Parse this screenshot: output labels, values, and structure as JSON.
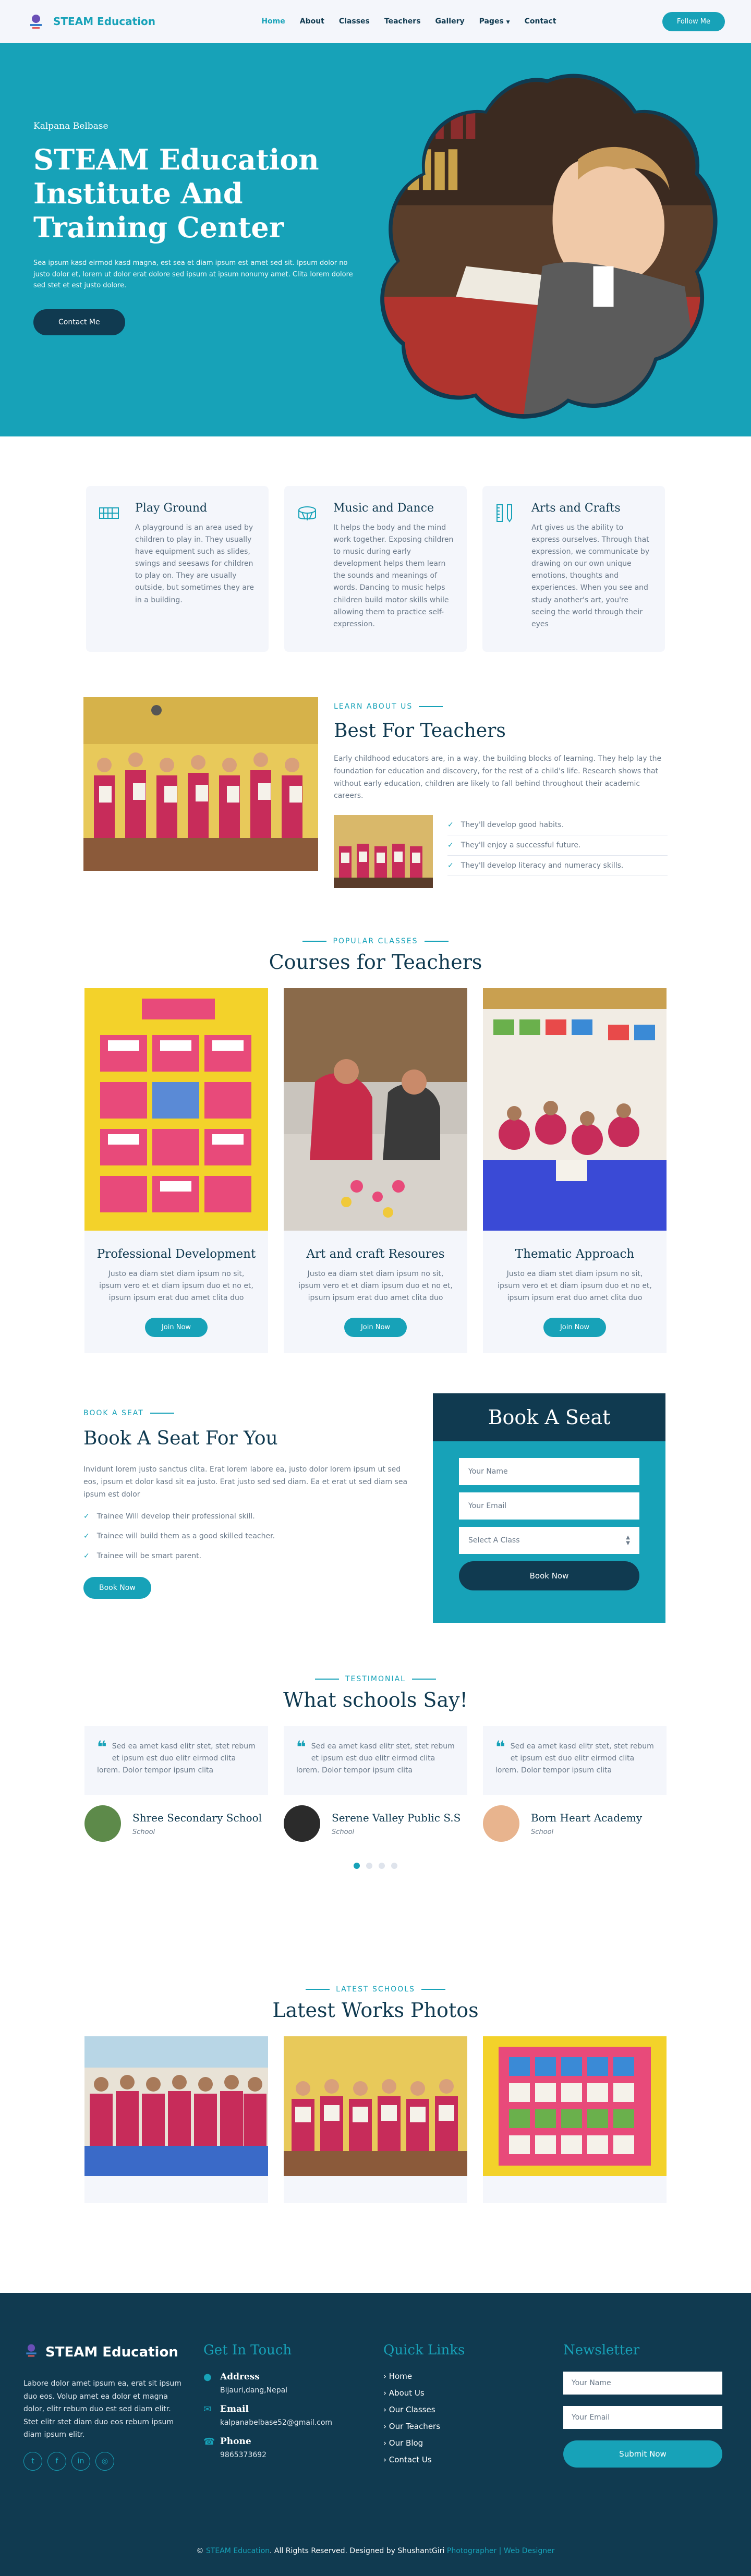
{
  "nav": {
    "brand": "STEAM Education",
    "items": [
      "Home",
      "About",
      "Classes",
      "Teachers",
      "Gallery",
      "Pages",
      "Contact"
    ],
    "follow_label": "Follow Me"
  },
  "hero": {
    "kicker": "Kalpana Belbase",
    "title": "STEAM Education Institute And Training Center",
    "desc": "Sea ipsum kasd eirmod kasd magna, est sea et diam ipsum est amet sed sit. Ipsum dolor no justo dolor et, lorem ut dolor erat dolore sed ipsum at ipsum nonumy amet. Clita lorem dolore sed stet et est justo dolore.",
    "cta": "Contact Me"
  },
  "facilities": [
    {
      "icon": "fence-icon",
      "title": "Play Ground",
      "text": "A playground is an area used by children to play in. They usually have equipment such as slides, swings and seesaws for children to play on. They are usually outside, but sometimes they are in a building."
    },
    {
      "icon": "drum-icon",
      "title": "Music and Dance",
      "text": "It helps the body and the mind work together. Exposing children to music during early development helps them learn the sounds and meanings of words. Dancing to music helps children build motor skills while allowing them to practice self-expression."
    },
    {
      "icon": "pencil-ruler-icon",
      "title": "Arts and Crafts",
      "text": "Art gives us the ability to express ourselves. Through that expression, we communicate by drawing on our own unique emotions, thoughts and experiences. When you see and study another's art, you're seeing the world through their eyes"
    }
  ],
  "about": {
    "kicker": "LEARN ABOUT US",
    "title": "Best For Teachers",
    "desc": "Early childhood educators are, in a way, the building blocks of learning. They help lay the foundation for education and discovery, for the rest of a child's life. Research shows that without early education, children are likely to fall behind throughout their academic careers.",
    "checks": [
      "They'll develop good habits.",
      "They'll enjoy a successful future.",
      "They'll develop literacy and numeracy skills."
    ]
  },
  "courses": {
    "kicker": "POPULAR CLASSES",
    "title": "Courses for Teachers",
    "items": [
      {
        "title": "Professional Development",
        "text": "Justo ea diam stet diam ipsum no sit, ipsum vero et et diam ipsum duo et no et, ipsum ipsum erat duo amet clita duo",
        "btn": "Join Now"
      },
      {
        "title": "Art and craft Resoures",
        "text": "Justo ea diam stet diam ipsum no sit, ipsum vero et et diam ipsum duo et no et, ipsum ipsum erat duo amet clita duo",
        "btn": "Join Now"
      },
      {
        "title": "Thematic Approach",
        "text": "Justo ea diam stet diam ipsum no sit, ipsum vero et et diam ipsum duo et no et, ipsum ipsum erat duo amet clita duo",
        "btn": "Join Now"
      }
    ]
  },
  "booking": {
    "kicker": "BOOK A SEAT",
    "title": "Book A Seat For You",
    "desc": "Invidunt lorem justo sanctus clita. Erat lorem labore ea, justo dolor lorem ipsum ut sed eos, ipsum et dolor kasd sit ea justo. Erat justo sed sed diam. Ea et erat ut sed diam sea ipsum est dolor",
    "checks": [
      "Trainee Will develop their professional skill.",
      "Trainee will build them as a good skilled teacher.",
      "Trainee will be smart parent."
    ],
    "btn": "Book Now",
    "form": {
      "title": "Book A Seat",
      "name_placeholder": "Your Name",
      "email_placeholder": "Your Email",
      "select_value": "Select A Class",
      "submit": "Book Now"
    }
  },
  "testimonials": {
    "kicker": "TESTIMONIAL",
    "title": "What schools Say!",
    "items": [
      {
        "quote": "Sed ea amet kasd elitr stet, stet rebum et ipsum est duo elitr eirmod clita lorem. Dolor tempor ipsum clita",
        "name": "Shree Secondary School",
        "role": "School",
        "avatar_color": "#5d8a4a"
      },
      {
        "quote": "Sed ea amet kasd elitr stet, stet rebum et ipsum est duo elitr eirmod clita lorem. Dolor tempor ipsum clita",
        "name": "Serene Valley Public S.S",
        "role": "School",
        "avatar_color": "#2b2b2b"
      },
      {
        "quote": "Sed ea amet kasd elitr stet, stet rebum et ipsum est duo elitr eirmod clita lorem. Dolor tempor ipsum clita",
        "name": "Born Heart Academy",
        "role": "School",
        "avatar_color": "#e8b48e"
      }
    ]
  },
  "works": {
    "kicker": "LATEST SCHOOLS",
    "title": "Latest Works Photos"
  },
  "footer": {
    "brand": "STEAM Education",
    "about": "Labore dolor amet ipsum ea, erat sit ipsum duo eos. Volup amet ea dolor et magna dolor, elitr rebum duo est sed diam elitr. Stet elitr stet diam duo eos rebum ipsum diam ipsum elitr.",
    "touch_title": "Get In Touch",
    "address_label": "Address",
    "address": "Bijauri,dang,Nepal",
    "email_label": "Email",
    "email": "kalpanabelbase52@gmail.com",
    "phone_label": "Phone",
    "phone": "9865373692",
    "links_title": "Quick Links",
    "links": [
      "Home",
      "About Us",
      "Our Classes",
      "Our Teachers",
      "Our Blog",
      "Contact Us"
    ],
    "news_title": "Newsletter",
    "news_name_placeholder": "Your Name",
    "news_email_placeholder": "Your Email",
    "news_submit": "Submit Now",
    "copy_pre": "©",
    "copy_brand": "STEAM Education",
    "copy_mid": ". All Rights Reserved. Designed by ShushantGiri",
    "copy_link1": "Photographer",
    "copy_sep": "|",
    "copy_link2": "Web Designer"
  },
  "colors": {
    "accent": "#17a2b8",
    "dark": "#103a50",
    "light": "#f4f6fb"
  }
}
